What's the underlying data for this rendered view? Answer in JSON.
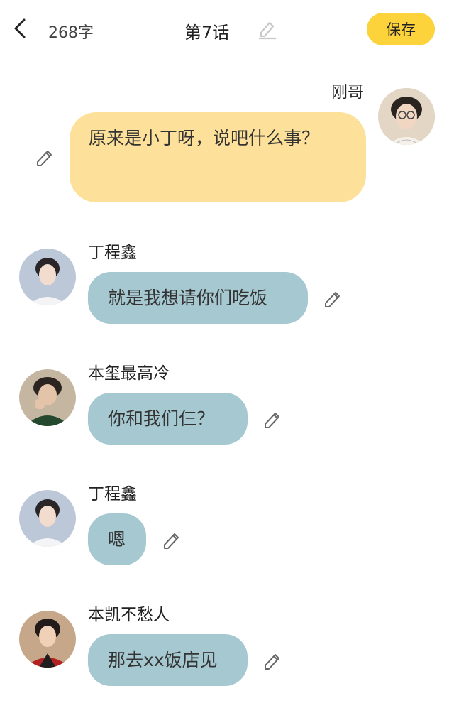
{
  "header": {
    "word_count": "268字",
    "chapter_title": "第7话",
    "save_label": "保存"
  },
  "messages": [
    {
      "sender": "刚哥",
      "text": "原来是小丁呀，说吧什么事？",
      "side": "right",
      "avatar_icon": "avatar-ganggе"
    },
    {
      "sender": "丁程鑫",
      "text": "就是我想请你们吃饭",
      "side": "left"
    },
    {
      "sender": "本玺最高冷",
      "text": "你和我们仨？",
      "side": "left"
    },
    {
      "sender": "丁程鑫",
      "text": "嗯",
      "side": "left"
    },
    {
      "sender": "本凯不愁人",
      "text": "那去xx饭店见",
      "side": "left"
    }
  ],
  "colors": {
    "accent": "#fcd33b",
    "self_bubble": "#fde19a",
    "other_bubble": "#a5c8d1"
  }
}
